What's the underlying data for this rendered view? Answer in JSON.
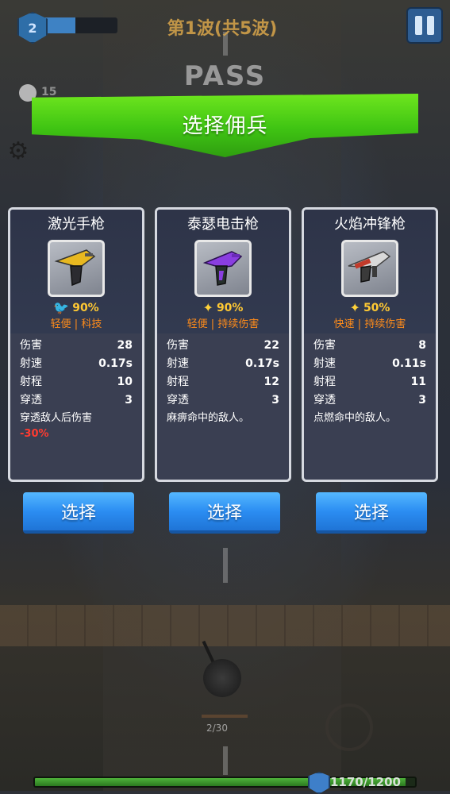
{
  "hud": {
    "player_level": "2",
    "xp_fraction": 0.45,
    "wave_title": "第1波(共5波)",
    "pass_label": "PASS",
    "kill_count": "15",
    "pause_icon": "pause-icon",
    "settings_icon": "gear-icon"
  },
  "banner": {
    "title": "选择佣兵"
  },
  "cards": [
    {
      "name": "激光手枪",
      "rate_icon": "blue-bird-icon",
      "rate_color": "#3fa8ff",
      "rate": "90%",
      "tags": "轻便 | 科技",
      "weapon_colors": {
        "main": "#e8b820",
        "dark": "#2b2b30"
      },
      "stats": [
        {
          "label": "伤害",
          "value": "28"
        },
        {
          "label": "射速",
          "value": "0.17s"
        },
        {
          "label": "射程",
          "value": "10"
        },
        {
          "label": "穿透",
          "value": "3"
        }
      ],
      "desc": "穿透敌人后伤害",
      "desc_extra": "-30%",
      "button": "选择"
    },
    {
      "name": "泰瑟电击枪",
      "rate_icon": "spark-icon",
      "rate_color": "#ffd23a",
      "rate": "90%",
      "tags": "轻便 | 持续伤害",
      "weapon_colors": {
        "main": "#8a3ee0",
        "dark": "#26302c"
      },
      "stats": [
        {
          "label": "伤害",
          "value": "22"
        },
        {
          "label": "射速",
          "value": "0.17s"
        },
        {
          "label": "射程",
          "value": "12"
        },
        {
          "label": "穿透",
          "value": "3"
        }
      ],
      "desc": "麻痹命中的敌人。",
      "desc_extra": "",
      "button": "选择"
    },
    {
      "name": "火焰冲锋枪",
      "rate_icon": "spark-icon",
      "rate_color": "#ffd23a",
      "rate": "50%",
      "tags": "快速 | 持续伤害",
      "weapon_colors": {
        "main": "#d9d9d9",
        "dark": "#3a3a3a"
      },
      "stats": [
        {
          "label": "伤害",
          "value": "8"
        },
        {
          "label": "射速",
          "value": "0.11s"
        },
        {
          "label": "射程",
          "value": "11"
        },
        {
          "label": "穿透",
          "value": "3"
        }
      ],
      "desc": "点燃命中的敌人。",
      "desc_extra": "",
      "button": "选择"
    }
  ],
  "bottom": {
    "ammo": "2/30",
    "hp_text": "1170/1200",
    "hp_fraction": 0.975
  }
}
